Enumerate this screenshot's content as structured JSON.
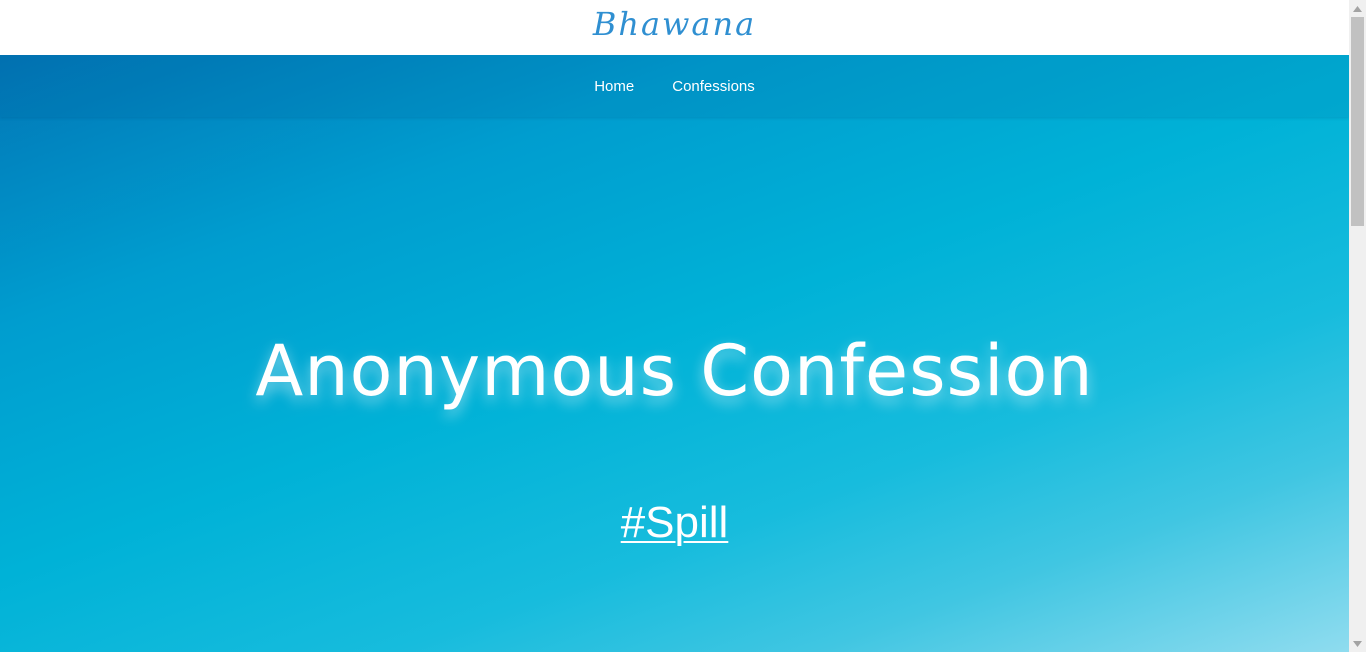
{
  "header": {
    "brand": "Bhawana"
  },
  "nav": {
    "items": [
      {
        "label": "Home"
      },
      {
        "label": "Confessions"
      }
    ]
  },
  "hero": {
    "title": "Anonymous Confession",
    "link_label": "#Spill"
  },
  "colors": {
    "brand": "#2f8fd1",
    "hero_gradient_start": "#0276b6",
    "hero_gradient_mid": "#00b2d7",
    "hero_gradient_end": "#8fdcef",
    "text": "#ffffff"
  },
  "icons": {
    "scroll_up": "triangle-up-icon",
    "scroll_down": "triangle-down-icon"
  }
}
